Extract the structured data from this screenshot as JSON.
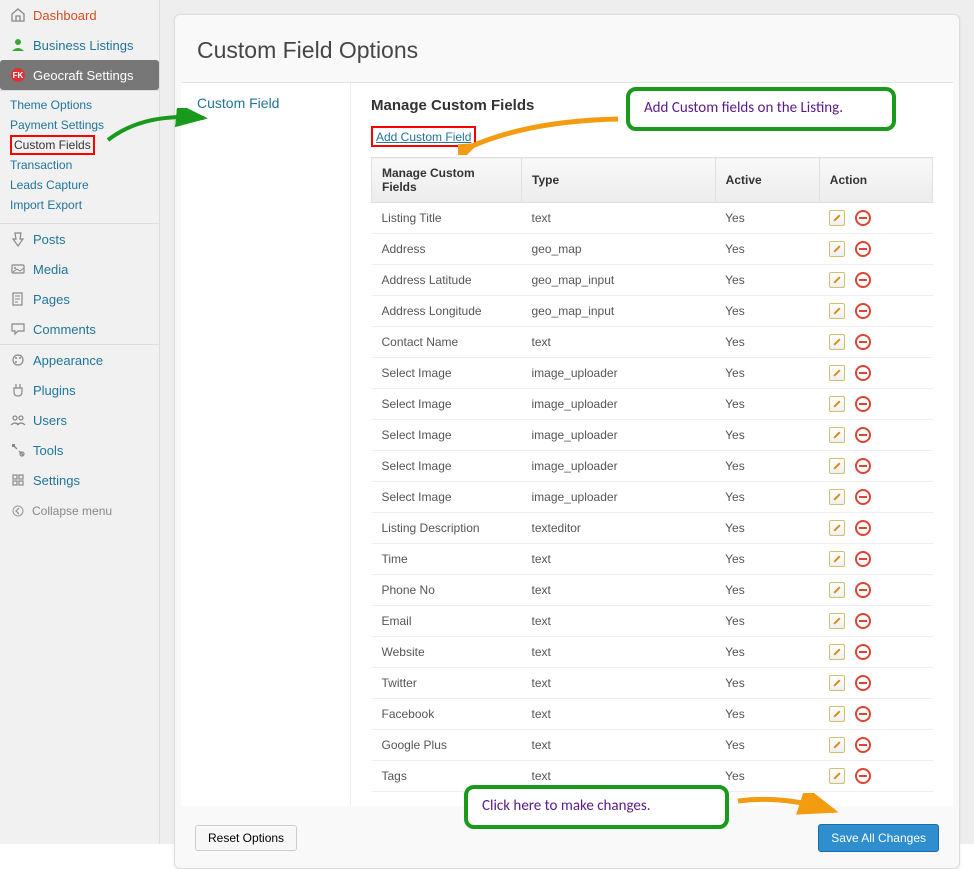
{
  "sidebar": {
    "top": [
      {
        "label": "Dashboard",
        "icon": "home"
      },
      {
        "label": "Business Listings",
        "icon": "user"
      },
      {
        "label": "Geocraft Settings",
        "icon": "fk",
        "active": true
      }
    ],
    "sub": [
      {
        "label": "Theme Options"
      },
      {
        "label": "Payment Settings"
      },
      {
        "label": "Custom Fields",
        "hl": true
      },
      {
        "label": "Transaction"
      },
      {
        "label": "Leads Capture"
      },
      {
        "label": "Import Export"
      }
    ],
    "bottom": [
      {
        "label": "Posts",
        "icon": "pin"
      },
      {
        "label": "Media",
        "icon": "media"
      },
      {
        "label": "Pages",
        "icon": "page"
      },
      {
        "label": "Comments",
        "icon": "chat"
      },
      {
        "label": "Appearance",
        "icon": "appearance"
      },
      {
        "label": "Plugins",
        "icon": "plug"
      },
      {
        "label": "Users",
        "icon": "users"
      },
      {
        "label": "Tools",
        "icon": "tools"
      },
      {
        "label": "Settings",
        "icon": "settings"
      }
    ],
    "collapse": "Collapse menu"
  },
  "panel": {
    "title": "Custom Field Options",
    "nav": "Custom Field",
    "heading": "Manage Custom Fields",
    "addLink": "Add Custom Field",
    "cols": [
      "Manage Custom Fields",
      "Type",
      "Active",
      "Action"
    ],
    "rows": [
      {
        "name": "Listing Title",
        "type": "text",
        "active": "Yes"
      },
      {
        "name": "Address",
        "type": "geo_map",
        "active": "Yes"
      },
      {
        "name": "Address Latitude",
        "type": "geo_map_input",
        "active": "Yes"
      },
      {
        "name": "Address Longitude",
        "type": "geo_map_input",
        "active": "Yes"
      },
      {
        "name": "Contact Name",
        "type": "text",
        "active": "Yes"
      },
      {
        "name": "Select Image",
        "type": "image_uploader",
        "active": "Yes"
      },
      {
        "name": "Select Image",
        "type": "image_uploader",
        "active": "Yes"
      },
      {
        "name": "Select Image",
        "type": "image_uploader",
        "active": "Yes"
      },
      {
        "name": "Select Image",
        "type": "image_uploader",
        "active": "Yes"
      },
      {
        "name": "Select Image",
        "type": "image_uploader",
        "active": "Yes"
      },
      {
        "name": "Listing Description",
        "type": "texteditor",
        "active": "Yes"
      },
      {
        "name": "Time",
        "type": "text",
        "active": "Yes"
      },
      {
        "name": "Phone No",
        "type": "text",
        "active": "Yes"
      },
      {
        "name": "Email",
        "type": "text",
        "active": "Yes"
      },
      {
        "name": "Website",
        "type": "text",
        "active": "Yes"
      },
      {
        "name": "Twitter",
        "type": "text",
        "active": "Yes"
      },
      {
        "name": "Facebook",
        "type": "text",
        "active": "Yes"
      },
      {
        "name": "Google Plus",
        "type": "text",
        "active": "Yes"
      },
      {
        "name": "Tags",
        "type": "text",
        "active": "Yes"
      }
    ],
    "reset": "Reset Options",
    "save": "Save All Changes"
  },
  "callouts": {
    "c1": "Add Custom fields on the Listing.",
    "c2": "Click here to make changes."
  }
}
